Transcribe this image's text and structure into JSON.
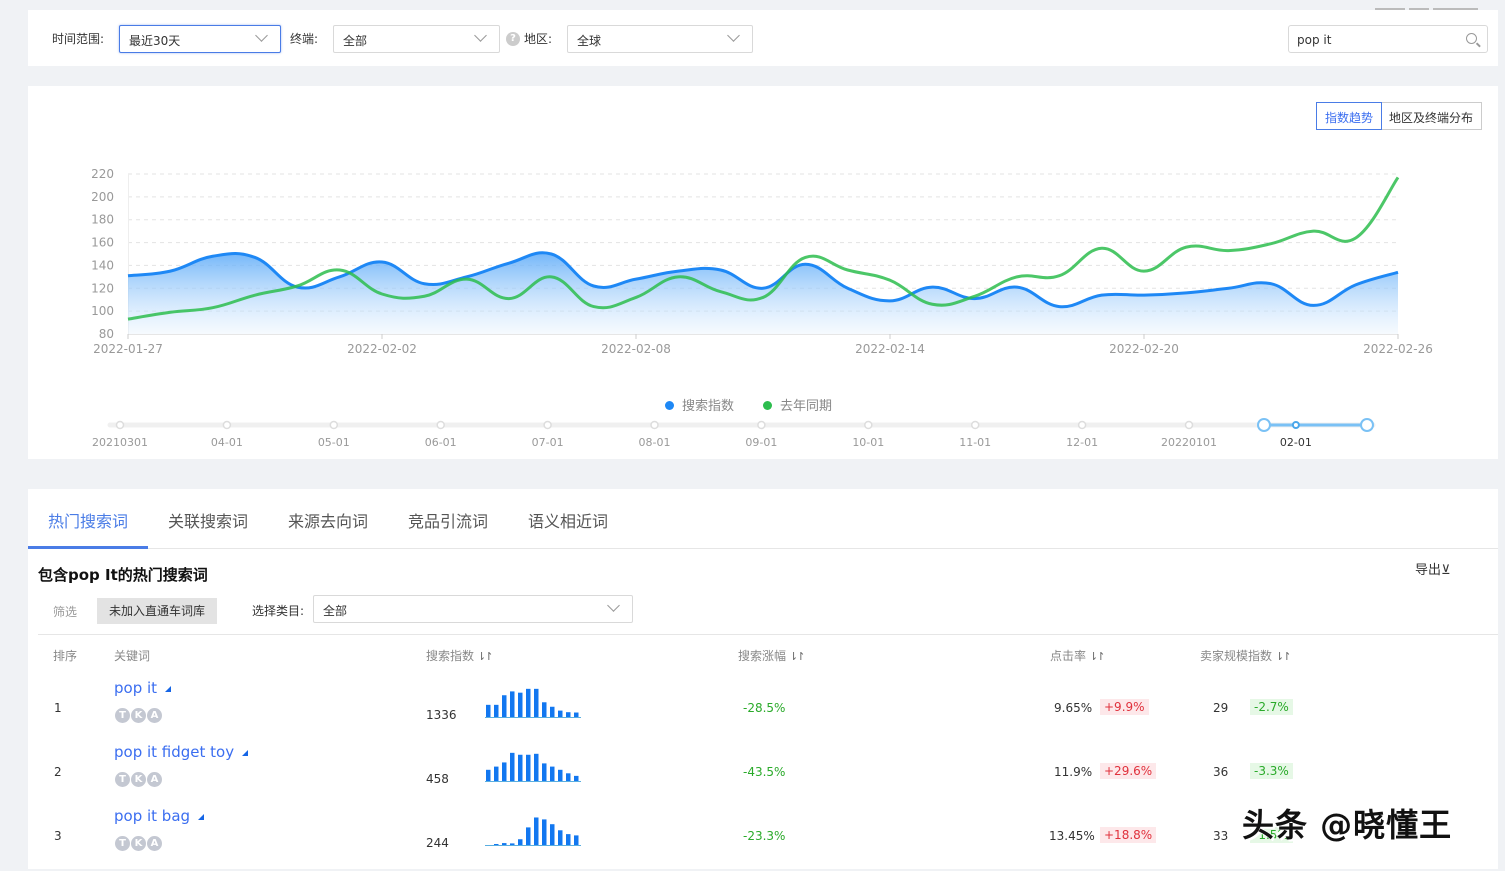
{
  "filters": {
    "time_range_label": "时间范围:",
    "time_range_value": "最近30天",
    "terminal_label": "终端:",
    "terminal_value": "全部",
    "help_glyph": "?",
    "region_label": "地区:",
    "region_value": "全球",
    "search_value": "pop it"
  },
  "chart_panel": {
    "toggle_trend": "指数趋势",
    "toggle_region": "地区及终端分布",
    "legend": [
      {
        "name": "搜索指数",
        "color": "#1e88f5"
      },
      {
        "name": "去年同期",
        "color": "#2dbd4e"
      }
    ],
    "timeline": {
      "labels": [
        "20210301",
        "04-01",
        "05-01",
        "06-01",
        "07-01",
        "08-01",
        "09-01",
        "10-01",
        "11-01",
        "12-01",
        "20220101",
        "02-01"
      ],
      "selected_label": "02-01"
    }
  },
  "chart_data": {
    "type": "line",
    "title": "",
    "xlabel": "",
    "ylabel": "",
    "ylim": [
      80,
      220
    ],
    "yticks": [
      80,
      100,
      120,
      140,
      160,
      180,
      200,
      220
    ],
    "x_tick_labels": [
      "2022-01-27",
      "2022-02-02",
      "2022-02-08",
      "2022-02-14",
      "2022-02-20",
      "2022-02-26"
    ],
    "x": [
      "2022-01-27",
      "2022-01-28",
      "2022-01-29",
      "2022-01-30",
      "2022-01-31",
      "2022-02-01",
      "2022-02-02",
      "2022-02-03",
      "2022-02-04",
      "2022-02-05",
      "2022-02-06",
      "2022-02-07",
      "2022-02-08",
      "2022-02-09",
      "2022-02-10",
      "2022-02-11",
      "2022-02-12",
      "2022-02-13",
      "2022-02-14",
      "2022-02-15",
      "2022-02-16",
      "2022-02-17",
      "2022-02-18",
      "2022-02-19",
      "2022-02-20",
      "2022-02-21",
      "2022-02-22",
      "2022-02-23",
      "2022-02-24",
      "2022-02-25",
      "2022-02-26"
    ],
    "grid": true,
    "legend_position": "bottom-center",
    "series": [
      {
        "name": "搜索指数",
        "color": "#1e88f5",
        "area": true,
        "values": [
          131,
          135,
          148,
          147,
          121,
          130,
          143,
          124,
          130,
          142,
          150,
          122,
          128,
          135,
          136,
          120,
          141,
          120,
          109,
          121,
          111,
          121,
          104,
          114,
          114,
          116,
          120,
          124,
          105,
          123,
          134
        ]
      },
      {
        "name": "去年同期",
        "color": "#2dbd4e",
        "area": false,
        "values": [
          93,
          99,
          103,
          114,
          122,
          136,
          115,
          113,
          128,
          111,
          130,
          104,
          112,
          130,
          117,
          112,
          147,
          136,
          127,
          106,
          113,
          130,
          131,
          155,
          135,
          156,
          153,
          159,
          170,
          164,
          217
        ]
      }
    ]
  },
  "table": {
    "tabs": [
      "热门搜索词",
      "关联搜索词",
      "来源去向词",
      "竞品引流词",
      "语义相近词"
    ],
    "active_tab": 0,
    "section_title": "包含pop It的热门搜索词",
    "export_label": "导出⊻",
    "filter_label": "筛选",
    "filter_chip": "未加入直通车词库",
    "category_label": "选择类目:",
    "category_value": "全部",
    "columns": [
      "排序",
      "关键词",
      "搜索指数",
      "搜索涨幅",
      "点击率",
      "卖家规模指数"
    ],
    "sort_glyph": "⇂↾",
    "badge_letters": [
      "T",
      "K",
      "A"
    ],
    "rows": [
      {
        "rank": "1",
        "keyword": "pop it",
        "search_index": "1336",
        "spark": [
          0.38,
          0.38,
          0.68,
          0.8,
          0.76,
          0.88,
          0.88,
          0.46,
          0.32,
          0.2,
          0.15,
          0.14
        ],
        "growth": "-28.5%",
        "ctr": "9.65%",
        "ctr_change": "+9.9%",
        "seller_index": "29",
        "seller_change": "-2.7%"
      },
      {
        "rank": "2",
        "keyword": "pop it fidget toy",
        "search_index": "458",
        "spark": [
          0.35,
          0.45,
          0.58,
          0.88,
          0.82,
          0.82,
          0.85,
          0.55,
          0.45,
          0.35,
          0.24,
          0.16
        ],
        "growth": "-43.5%",
        "ctr": "11.9%",
        "ctr_change": "+29.6%",
        "seller_index": "36",
        "seller_change": "-3.3%"
      },
      {
        "rank": "3",
        "keyword": "pop it bag",
        "search_index": "244",
        "spark": [
          0.0,
          0.02,
          0.06,
          0.05,
          0.18,
          0.55,
          0.86,
          0.8,
          0.65,
          0.46,
          0.34,
          0.3
        ],
        "growth": "-23.3%",
        "ctr": "13.45%",
        "ctr_change": "+18.8%",
        "seller_index": "33",
        "seller_change": "-1.5%"
      }
    ]
  },
  "watermark": "头条 @晓懂王"
}
